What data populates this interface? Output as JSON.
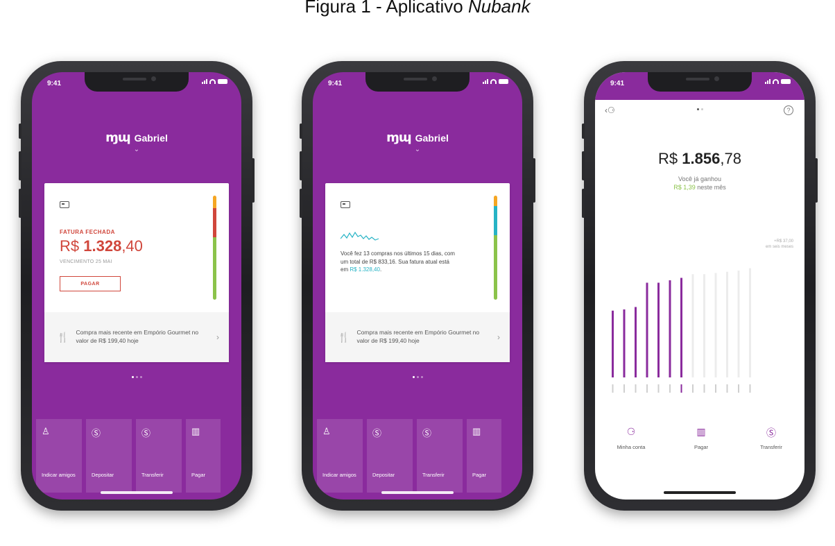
{
  "caption": {
    "prefix": "Figura 1 - Aplicativo ",
    "app_name": "Nubank"
  },
  "status": {
    "time": "9:41"
  },
  "phone1": {
    "user": "Gabriel",
    "fatura_label": "FATURA FECHADA",
    "fatura_currency": "R$ ",
    "fatura_int": "1.328",
    "fatura_dec": ",40",
    "vencimento": "VENCIMENTO 25 MAI",
    "pagar_label": "PAGAR",
    "recent": "Compra mais recente em Empório Gourmet no valor de R$ 199,40 hoje",
    "stripe_colors": [
      "#f5a623",
      "#d0463b",
      "#8bc34a"
    ]
  },
  "phone2": {
    "user": "Gabriel",
    "info_text": "Você fez 13 compras nos últimos 15 dias, com um total de R$ 833,16. Sua fatura atual está em ",
    "info_highlight": "R$ 1.328,40",
    "info_end": ".",
    "recent": "Compra mais recente em Empório Gourmet no valor de R$ 199,40 hoje",
    "stripe_colors": [
      "#f5a623",
      "#26b3c5",
      "#8bc34a"
    ]
  },
  "actions": [
    {
      "label": "Indicar amigos",
      "icon": "user-plus-icon",
      "glyph": "♙"
    },
    {
      "label": "Depositar",
      "icon": "deposit-icon",
      "glyph": "Ⓢ"
    },
    {
      "label": "Transferir",
      "icon": "transfer-icon",
      "glyph": "Ⓢ"
    },
    {
      "label": "Pagar",
      "icon": "barcode-icon",
      "glyph": "▥"
    }
  ],
  "phone3": {
    "balance_currency": "R$ ",
    "balance_int": "1.856",
    "balance_dec": ",78",
    "ganhou_line1": "Você já ganhou",
    "ganhou_amount": "R$ 1,39",
    "ganhou_line2": " neste mês",
    "chart_note_1": "+R$ 37,00",
    "chart_note_2": "em seis meses",
    "bar_values": [
      0.55,
      0.56,
      0.58,
      0.78,
      0.78,
      0.8,
      0.82,
      0.85,
      0.85,
      0.86,
      0.87,
      0.88,
      0.9
    ],
    "bar_active_count": 7,
    "actions": [
      {
        "label": "Minha conta",
        "icon": "account-icon",
        "glyph": "⚆"
      },
      {
        "label": "Pagar",
        "icon": "barcode-icon",
        "glyph": "▥"
      },
      {
        "label": "Transferir",
        "icon": "transfer-icon",
        "glyph": "Ⓢ"
      }
    ]
  },
  "colors": {
    "purple": "#8a2b9d",
    "red": "#d0463b",
    "green": "#8bc34a",
    "teal": "#26b3c5"
  }
}
